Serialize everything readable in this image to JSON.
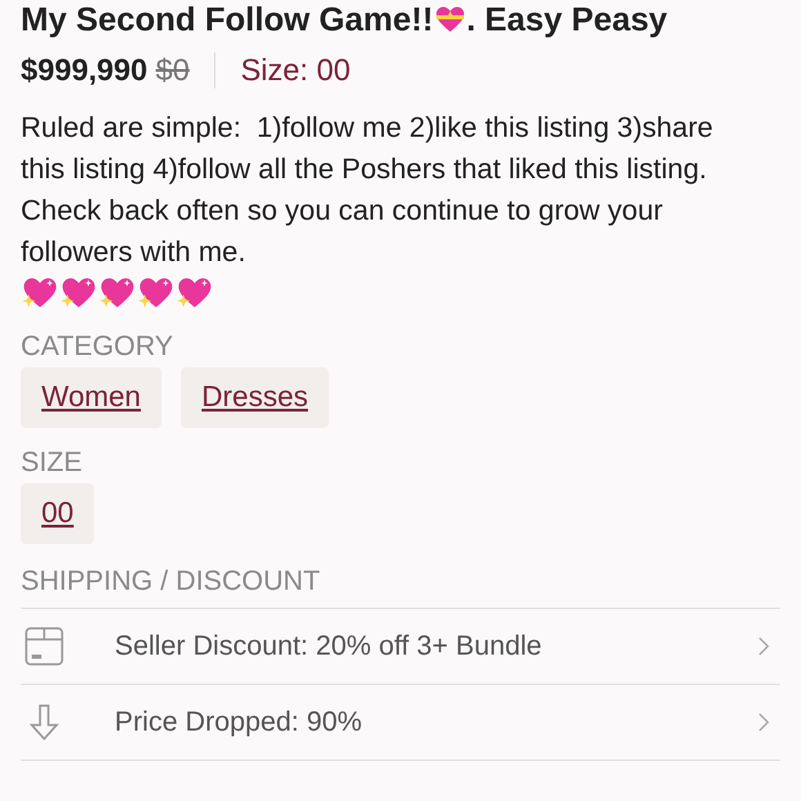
{
  "title": {
    "before_icon": "My Second Follow Game!!",
    "after_icon": ". Easy Peasy"
  },
  "price": {
    "current": "$999,990",
    "original": "$0",
    "size": "Size: 00"
  },
  "description": {
    "text": "Ruled are simple:  1)follow me 2)like this listing 3)share this listing 4)follow all the Poshers that liked this listing.  Check back often so you can continue to grow your followers with me.",
    "hearts": [
      {
        "kind": "sparkle"
      },
      {
        "kind": "sparkle"
      },
      {
        "kind": "sparkle"
      },
      {
        "kind": "sparkle"
      },
      {
        "kind": "sparkle"
      }
    ]
  },
  "sections": [
    {
      "heading": "CATEGORY",
      "tags": [
        "Women",
        "Dresses"
      ]
    },
    {
      "heading": "SIZE",
      "tags": [
        "00"
      ]
    }
  ],
  "shipping": {
    "heading": "SHIPPING / DISCOUNT",
    "rows": [
      {
        "kind": "box",
        "label": "Seller Discount: 20% off 3+ Bundle"
      },
      {
        "kind": "arrow",
        "label": "Price Dropped: 90%"
      }
    ]
  }
}
